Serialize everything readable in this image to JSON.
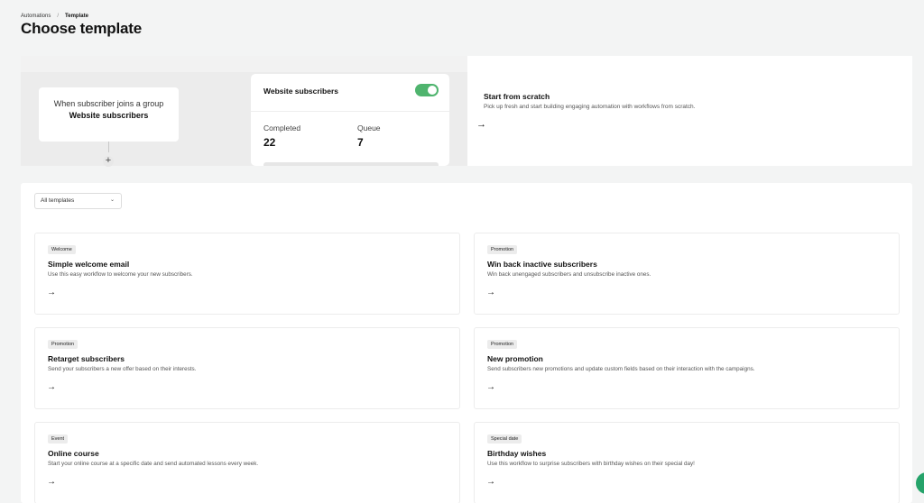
{
  "breadcrumb": {
    "parent": "Automations",
    "separator": "/",
    "current": "Template"
  },
  "page_title": "Choose template",
  "trigger": {
    "prefix": "When subscriber joins a group",
    "group_name": "Website subscribers"
  },
  "plus_symbol": "+",
  "stats": {
    "title": "Website subscribers",
    "toggle_on": true,
    "completed_label": "Completed",
    "completed_value": "22",
    "queue_label": "Queue",
    "queue_value": "7"
  },
  "scratch": {
    "title": "Start from scratch",
    "description": "Pick up fresh and start building engaging automation with workflows from scratch.",
    "arrow": "→"
  },
  "filter": {
    "selected": "All templates",
    "chevron": "⌄"
  },
  "templates": [
    {
      "badge": "Welcome",
      "title": "Simple welcome email",
      "description": "Use this easy workflow to welcome your new subscribers.",
      "arrow": "→"
    },
    {
      "badge": "Promotion",
      "title": "Win back inactive subscribers",
      "description": "Win back unengaged subscribers and unsubscribe inactive ones.",
      "arrow": "→"
    },
    {
      "badge": "Promotion",
      "title": "Retarget subscribers",
      "description": "Send your subscribers a new offer based on their interests.",
      "arrow": "→"
    },
    {
      "badge": "Promotion",
      "title": "New promotion",
      "description": "Send subscribers new promotions and update custom fields based on their interaction with the campaigns.",
      "arrow": "→"
    },
    {
      "badge": "Event",
      "title": "Online course",
      "description": "Start your online course at a specific date and send automated lessons every week.",
      "arrow": "→"
    },
    {
      "badge": "Special date",
      "title": "Birthday wishes",
      "description": "Use this workflow to surprise subscribers with birthday wishes on their special day!",
      "arrow": "→"
    }
  ],
  "colors": {
    "accent_green": "#4fb46e",
    "background": "#f3f4f4"
  }
}
